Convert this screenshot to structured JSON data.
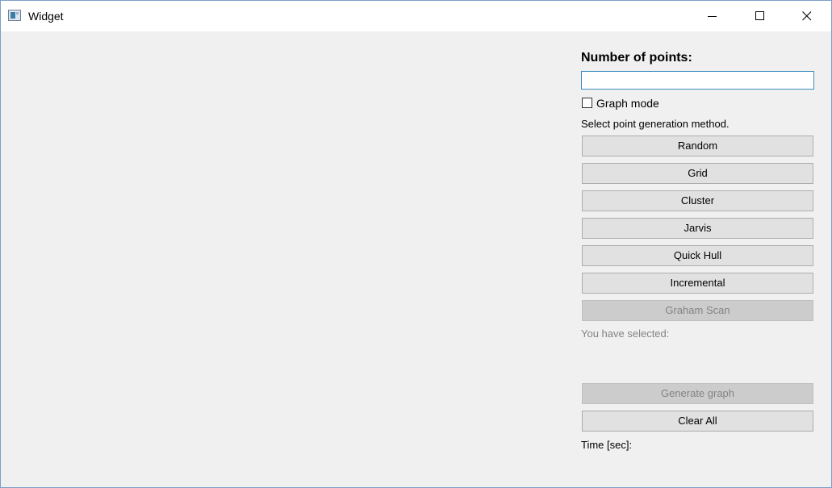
{
  "window": {
    "title": "Widget",
    "icons": {
      "app": "app-window-icon",
      "minimize": "minimize-icon",
      "maximize": "maximize-icon",
      "close": "close-icon"
    }
  },
  "panel": {
    "heading": "Number of points:",
    "points_input": {
      "value": "",
      "placeholder": ""
    },
    "graph_mode": {
      "label": "Graph mode",
      "checked": false
    },
    "select_method_label": "Select point generation method.",
    "buttons": [
      {
        "label": "Random",
        "enabled": true
      },
      {
        "label": "Grid",
        "enabled": true
      },
      {
        "label": "Cluster",
        "enabled": true
      },
      {
        "label": "Jarvis",
        "enabled": true
      },
      {
        "label": "Quick Hull",
        "enabled": true
      },
      {
        "label": "Incremental",
        "enabled": true
      },
      {
        "label": "Graham Scan",
        "enabled": false
      }
    ],
    "selected_label": "You have selected:",
    "generate_graph": {
      "label": "Generate graph",
      "enabled": false
    },
    "clear_all": {
      "label": "Clear All",
      "enabled": true
    },
    "time_label": "Time [sec]:"
  },
  "colors": {
    "background": "#f0f0f0",
    "titlebar": "#ffffff",
    "button": "#e1e1e1",
    "button_disabled": "#cccccc",
    "text_disabled": "#838383",
    "input_focus_border": "#3c8dbc"
  }
}
